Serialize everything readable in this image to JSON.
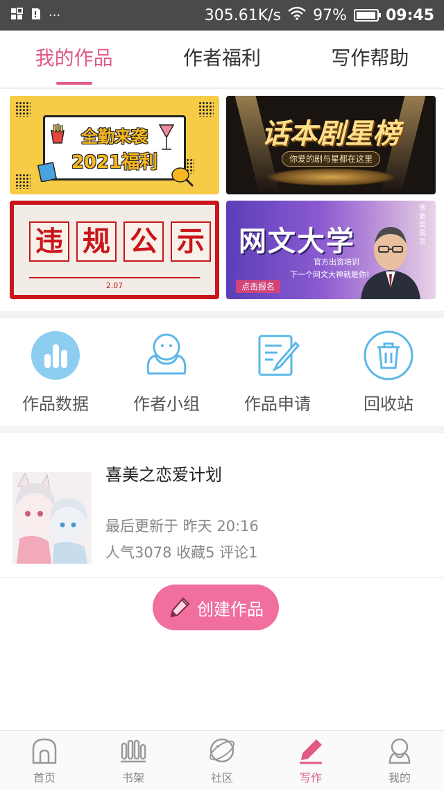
{
  "status_bar": {
    "network_speed": "305.61K/s",
    "battery_percent": "97%",
    "battery_level": 0.97,
    "time": "09:45",
    "overflow": "···"
  },
  "top_tabs": [
    {
      "label": "我的作品",
      "active": true
    },
    {
      "label": "作者福利",
      "active": false
    },
    {
      "label": "写作帮助",
      "active": false
    }
  ],
  "banners": {
    "welfare": {
      "line1": "全勤来袭",
      "line2": "2021福利"
    },
    "drama": {
      "title": "话本剧星榜",
      "subtitle": "你爱的剧与星都在这里"
    },
    "violation": {
      "chars": [
        "违",
        "规",
        "公",
        "示"
      ],
      "date": "2.07"
    },
    "university": {
      "title": "网文大学",
      "line1": "官方出资培训",
      "line2": "下一个网文大神就是你!",
      "button": "点击报名",
      "side": "茅盾奖 莫言"
    }
  },
  "shortcuts": [
    {
      "label": "作品数据",
      "icon": "bar-chart-icon"
    },
    {
      "label": "作者小组",
      "icon": "group-icon"
    },
    {
      "label": "作品申请",
      "icon": "edit-document-icon"
    },
    {
      "label": "回收站",
      "icon": "trash-icon"
    }
  ],
  "work": {
    "title": "喜美之恋爱计划",
    "updated": "最后更新于 昨天 20:16",
    "stats": "人气3078 收藏5 评论1"
  },
  "create_button": {
    "label": "创建作品",
    "icon": "pencil-icon"
  },
  "bottom_nav": [
    {
      "label": "首页",
      "icon": "home-icon",
      "active": false
    },
    {
      "label": "书架",
      "icon": "bookshelf-icon",
      "active": false
    },
    {
      "label": "社区",
      "icon": "planet-icon",
      "active": false
    },
    {
      "label": "写作",
      "icon": "pen-icon",
      "active": true
    },
    {
      "label": "我的",
      "icon": "profile-icon",
      "active": false
    }
  ],
  "colors": {
    "accent": "#e25a84",
    "button": "#f06f9f",
    "status_bar": "#4a4a4a",
    "shortcut_blue": "#5bb7e8"
  }
}
